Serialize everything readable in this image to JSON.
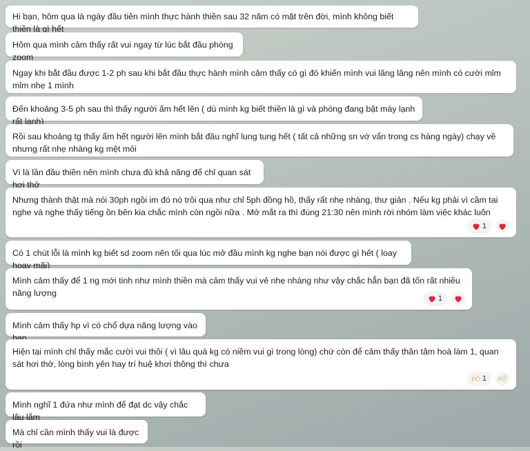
{
  "messages": [
    {
      "text": "Hi bạn, hôm qua là ngày đầu tiên mình thực hành thiền sau 32 năm có mặt trên đời, mình không biết thiền là gì hết"
    },
    {
      "text": "Hôm qua mình cảm thấy rất vui ngay từ lúc bắt đầu phòng zoom"
    },
    {
      "text": "Ngay khi bắt đầu được 1-2 ph sau khi bắt đầu thực hành mình cảm thấy có gì đó khiến mình vui lâng lâng nên mình có cười mỉm mỉm nhẹ 1 mình"
    },
    {
      "text": "Đến khoảng 3-5 ph sau thì thấy người ấm hết lên ( dù mình kg biết thiền là gì và phòng đang bật máy lạnh rất lạnh)"
    },
    {
      "text": "Rồi sau khoảng tg thấy ấm hết người lên mình bắt đầu nghĩ lung tung hết ( tất cả những sn vớ vẩn trong cs hàng ngày) chạy về nhưng rất nhẹ nhàng kg mệt mỏi"
    },
    {
      "text": "Vì là lần đầu thiền nên mình chưa đủ khả năng để chỉ quan sát hơi thở"
    },
    {
      "text": "Nhưng thành thật mà nói 30ph ngồi im đó nó trôi qua như chỉ 5ph đồng hồ, thấy rất nhẹ nhàng, thư giản . Nếu kg phải vì cầm tai nghe và nghe thấy tiếng ồn bên kia chắc mình còn ngồi nữa . Mở mắt ra thì đúng 21:30 nên mình rời nhóm làm việc khác luôn",
      "reaction": {
        "icon": "heart-icon",
        "count": "1"
      }
    },
    {
      "text": "Có 1 chút lỗi là mình kg biết sd zoom nên tối qua lúc mở đầu mình kg nghe bạn nói được gì hết ( loay hoay mãi)"
    },
    {
      "text": "Mình cảm thấy để 1 ng mới tinh như mình thiền mà cảm thấy vui vẻ nhẹ nhàng như vậy chắc hẳn bạn đã tốn rất nhiều năng lượng",
      "reaction": {
        "icon": "heart-icon",
        "count": "1"
      }
    },
    {
      "text": "Mình cảm thấy hp vì có chổ dựa năng lượng vào bạn"
    },
    {
      "text": "Hiện tại mình chỉ thấy mắc cười vui thôi ( vì lâu quá kg có niềm vui gì trong lòng) chứ còn để cảm thấy thân tâm hoà làm 1, quan sát hơi thở, lòng bình yên hay trí huệ khơi thông thì chưa",
      "reaction": {
        "icon": "thumbs-up-icon",
        "count": "1"
      }
    },
    {
      "text": "Mình nghĩ 1 đứa như mình để đạt dc vậy chắc lâu lắm"
    },
    {
      "text": "Mà chỉ cần mình thấy vui là được rồi"
    }
  ],
  "colors": {
    "heart": "#e0263c",
    "thumb": "#e8a623",
    "bubble": "#ffffff"
  }
}
